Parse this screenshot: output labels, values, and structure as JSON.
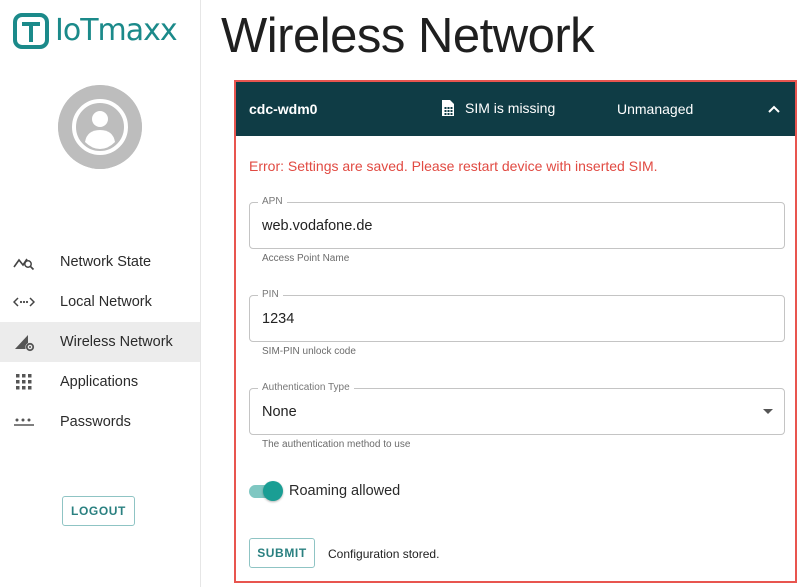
{
  "app": {
    "logo_text": "IoTmaxx",
    "brand_color": "#1b8a8a"
  },
  "sidebar": {
    "items": [
      {
        "label": "Network State",
        "icon": "network-state-icon",
        "active": false
      },
      {
        "label": "Local Network",
        "icon": "local-network-icon",
        "active": false
      },
      {
        "label": "Wireless Network",
        "icon": "wireless-network-icon",
        "active": true
      },
      {
        "label": "Applications",
        "icon": "grid-icon",
        "active": false
      },
      {
        "label": "Passwords",
        "icon": "password-icon",
        "active": false
      }
    ],
    "logout_label": "LOGOUT"
  },
  "main": {
    "title": "Wireless Network",
    "panel": {
      "device_name": "cdc-wdm0",
      "sim_status": "SIM is missing",
      "managed_status": "Unmanaged",
      "header_color": "#0f3c45",
      "error_color": "#e14a42",
      "error_message": "Error: Settings are saved. Please restart device with inserted SIM.",
      "apn": {
        "label": "APN",
        "value": "web.vodafone.de",
        "helper": "Access Point Name"
      },
      "pin": {
        "label": "PIN",
        "value": "1234",
        "helper": "SIM-PIN unlock code"
      },
      "auth": {
        "label": "Authentication Type",
        "value": "None",
        "helper": "The authentication method to use"
      },
      "roaming": {
        "label": "Roaming allowed",
        "enabled": true
      },
      "submit_label": "SUBMIT",
      "submit_status": "Configuration stored."
    }
  }
}
